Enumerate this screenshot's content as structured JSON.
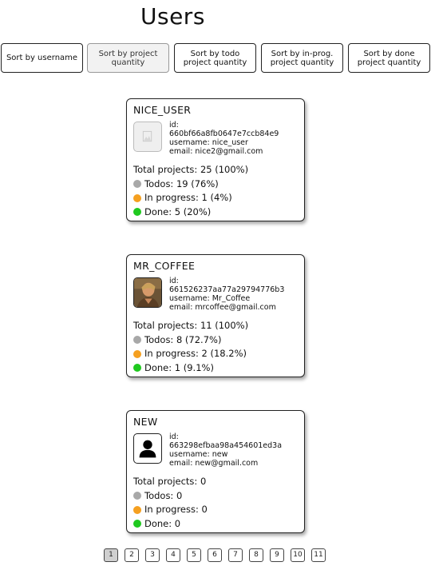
{
  "header": {
    "title": "Users"
  },
  "sort_buttons": [
    {
      "label": "Sort by username",
      "active": false
    },
    {
      "label": "Sort by project quantity",
      "active": true
    },
    {
      "label": "Sort by todo project quantity",
      "active": false
    },
    {
      "label": "Sort by in-prog. project quantity",
      "active": false
    },
    {
      "label": "Sort by done project quantity",
      "active": false
    }
  ],
  "users": [
    {
      "name": "NICE_USER",
      "avatar": "broken-image-icon",
      "id_label": "id:",
      "id": "660bf66a8fb0647e7ccb84e9",
      "username": "username: nice_user",
      "email": "email: nice2@gmail.com",
      "total": "Total projects: 25 (100%)",
      "todos": "Todos: 19 (76%)",
      "in_progress": "In progress: 1 (4%)",
      "done": "Done: 5 (20%)"
    },
    {
      "name": "MR_COFFEE",
      "avatar": "user-photo",
      "id_label": "id:",
      "id": "661526237aa77a29794776b3",
      "username": "username: Mr_Coffee",
      "email": "email: mrcoffee@gmail.com",
      "total": "Total projects: 11 (100%)",
      "todos": "Todos: 8 (72.7%)",
      "in_progress": "In progress: 2 (18.2%)",
      "done": "Done: 1 (9.1%)"
    },
    {
      "name": "NEW",
      "avatar": "default-person-icon",
      "id_label": "id:",
      "id": "663298efbaa98a454601ed3a",
      "username": "username: new",
      "email": "email: new@gmail.com",
      "total": "Total projects: 0",
      "todos": "Todos: 0",
      "in_progress": "In progress: 0",
      "done": "Done: 0"
    }
  ],
  "status_colors": {
    "todo": "#a8a8a8",
    "in_progress": "#f5a020",
    "done": "#1fc91f"
  },
  "pagination": {
    "current": "1",
    "pages": [
      "1",
      "2",
      "3",
      "4",
      "5",
      "6",
      "7",
      "8",
      "9",
      "10",
      "11"
    ]
  }
}
